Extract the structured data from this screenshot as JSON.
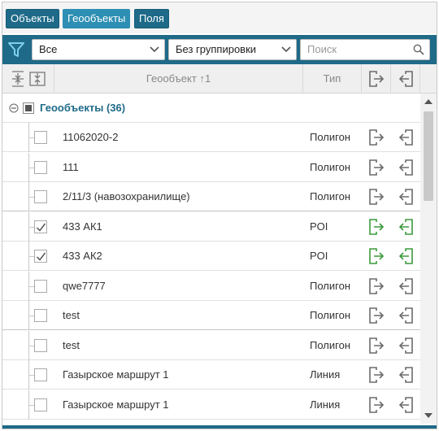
{
  "tabs": [
    {
      "label": "Объекты",
      "style": "dark"
    },
    {
      "label": "Геообъекты",
      "style": "light"
    },
    {
      "label": "Поля",
      "style": "dark"
    }
  ],
  "filters": {
    "filter_select": "Все",
    "group_select": "Без группировки",
    "search_placeholder": "Поиск"
  },
  "table": {
    "header_name": "Геообъект ↑1",
    "header_type": "Тип",
    "group_label": "Геообъекты (36)",
    "rows": [
      {
        "name": "11062020-2",
        "type": "Полигон",
        "checked": false
      },
      {
        "name": "111",
        "type": "Полигон",
        "checked": false
      },
      {
        "name": "2/11/3 (навозохранилище)",
        "type": "Полигон",
        "checked": false
      },
      {
        "name": "433 АК1",
        "type": "POI",
        "checked": true
      },
      {
        "name": "433 АК2",
        "type": "POI",
        "checked": true
      },
      {
        "name": "qwe7777",
        "type": "Полигон",
        "checked": false
      },
      {
        "name": "test",
        "type": "Полигон",
        "checked": false
      },
      {
        "name": "test",
        "type": "Полигон",
        "checked": false
      },
      {
        "name": "Газырское маршрут 1",
        "type": "Линия",
        "checked": false
      },
      {
        "name": "Газырское маршрут 1",
        "type": "Линия",
        "checked": false
      }
    ]
  },
  "colors": {
    "accent": "#1e6a88",
    "active_icon": "#3c9a3c",
    "inactive_icon": "#6b6b6b"
  },
  "icons": {
    "filter": "funnel-icon",
    "export": "export-arrow-icon",
    "import": "import-arrow-icon",
    "expand_collapse": "expand-collapse-icon",
    "search": "search-icon"
  }
}
